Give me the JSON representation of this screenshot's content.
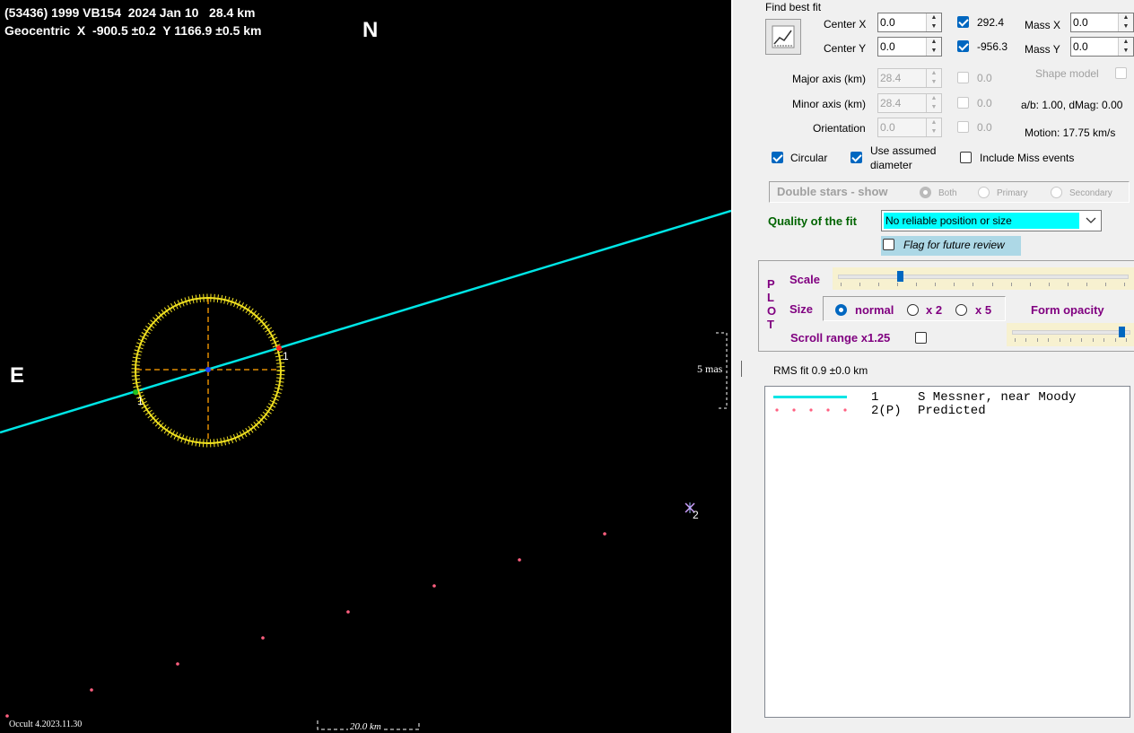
{
  "plot": {
    "header_line1": "(53436) 1999 VB154  2024 Jan 10   28.4 km",
    "header_line2": "Geocentric  X  -900.5 ±0.2  Y 1166.9 ±0.5 km",
    "north_label": "N",
    "east_label": "E",
    "mas_label": "5 mas",
    "chord1_label_a": "1",
    "chord1_label_b": "1",
    "predicted_label": "2",
    "version": "Occult 4.2023.11.30",
    "scale_bar_label": "20.0 km"
  },
  "fit": {
    "title": "Find best fit",
    "center_x_label": "Center X",
    "center_x_value": "0.0",
    "center_y_label": "Center Y",
    "center_y_value": "0.0",
    "cx_fit_value": "292.4",
    "cy_fit_value": "-956.3",
    "mass_x_label": "Mass X",
    "mass_x_value": "0.0",
    "mass_y_label": "Mass Y",
    "mass_y_value": "0.0",
    "major_label": "Major axis (km)",
    "major_value": "28.4",
    "major_check_value": "0.0",
    "minor_label": "Minor axis (km)",
    "minor_value": "28.4",
    "minor_check_value": "0.0",
    "orient_label": "Orientation",
    "orient_value": "0.0",
    "orient_check_value": "0.0",
    "shape_model_label": "Shape model",
    "ab_text": "a/b: 1.00, dMag: 0.00",
    "motion_text": "Motion: 17.75 km/s",
    "circular_label": "Circular",
    "assumed_label_1": "Use assumed",
    "assumed_label_2": "diameter",
    "miss_label": "Include Miss events",
    "double_stars_label": "Double stars - show",
    "both_label": "Both",
    "primary_label": "Primary",
    "secondary_label": "Secondary",
    "quality_label": "Quality of the fit",
    "quality_value": "No reliable position or size",
    "flag_label": "Flag for future review"
  },
  "plotbox": {
    "p": "P",
    "l": "L",
    "o": "O",
    "t": "T",
    "scale_label": "Scale",
    "size_label": "Size",
    "normal_label": "normal",
    "x2_label": "x 2",
    "x5_label": "x 5",
    "opacity_label": "Form opacity",
    "scroll_label": "Scroll range x1.25",
    "scale_level": 0.21,
    "opacity_level": 0.97
  },
  "rms_text": "RMS fit 0.9 ±0.0 km",
  "chords": [
    {
      "num": "1",
      "observer": "S Messner, near Moody"
    },
    {
      "num": "2(P)",
      "observer": "Predicted"
    }
  ],
  "colors": {
    "chord": "#00e5e5",
    "ellipse": "#f0e020",
    "predicted": "#ff6080",
    "quality_bg": "#00ffff",
    "label_green": "#006400",
    "plot_purple": "#800080",
    "flag_bg": "#add8e6",
    "slider_bg": "#f7f1d0"
  },
  "icons": {
    "fit_button": "chart-fit-icon",
    "dropdown": "chevron-down-icon"
  }
}
